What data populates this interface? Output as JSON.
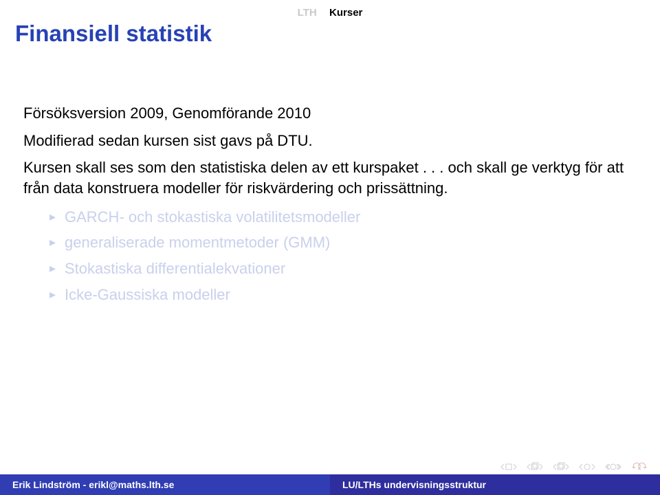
{
  "nav": {
    "item1": "LTH",
    "item2": "Kurser"
  },
  "title": "Finansiell statistik",
  "body": {
    "p1": "Försöksversion 2009, Genomförande 2010",
    "p2": "Modifierad sedan kursen sist gavs på DTU.",
    "p3": "Kursen skall ses som den statistiska delen av ett kurspaket . . . och skall ge verktyg för att från data konstruera modeller för riskvärdering och prissättning."
  },
  "bullets": {
    "b1": "GARCH- och stokastiska volatilitetsmodeller",
    "b2": "generaliserade momentmetoder (GMM)",
    "b3": "Stokastiska differentialekvationer",
    "b4": "Icke-Gaussiska modeller"
  },
  "footer": {
    "left": "Erik Lindström - erikl@maths.lth.se",
    "right": "LU/LTHs undervisningsstruktur"
  },
  "colors": {
    "title": "#2742b5",
    "footer_left": "#303db3",
    "footer_right": "#2e2e9e",
    "dim": "#c9d0ec"
  }
}
